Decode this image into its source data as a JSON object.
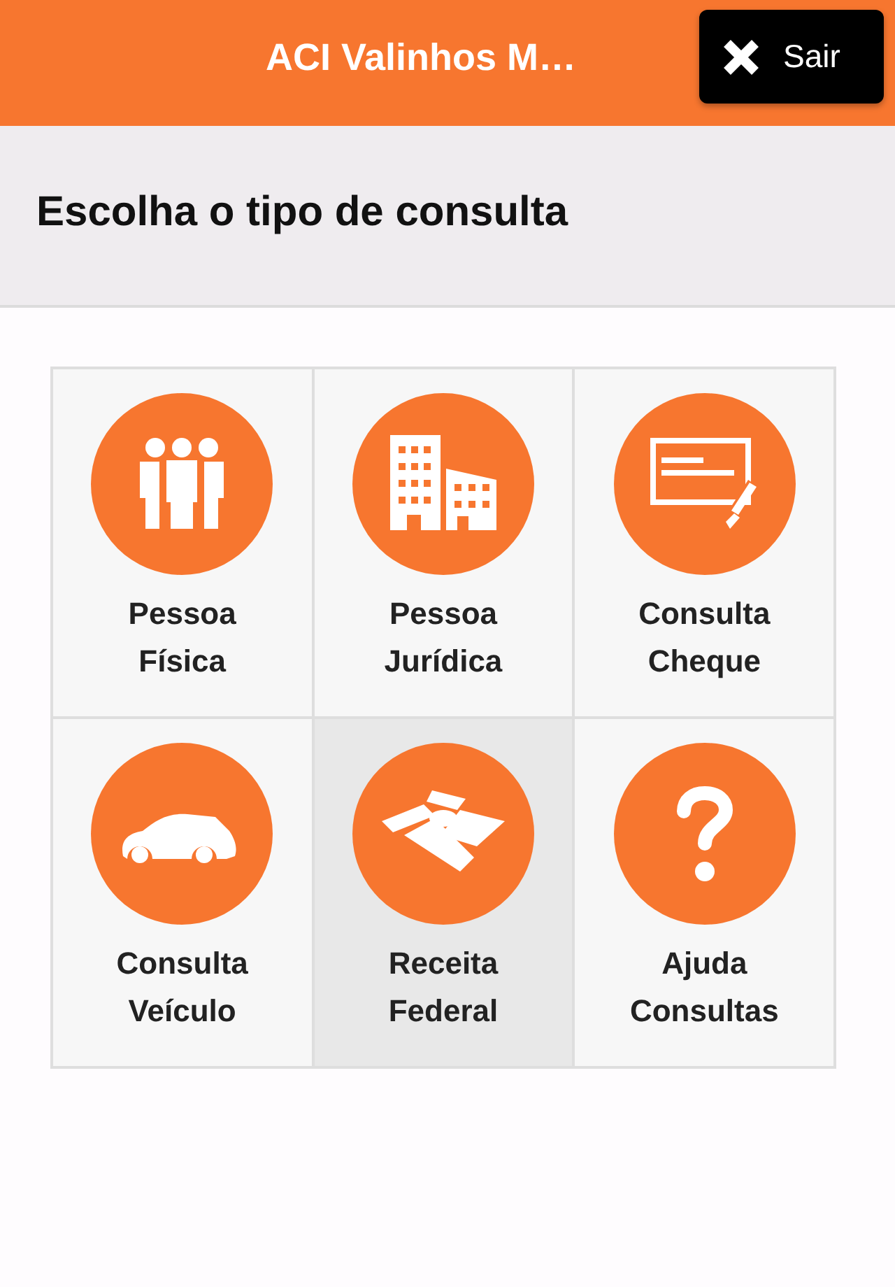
{
  "header": {
    "title": "ACI Valinhos M…",
    "logout_button": "Sair"
  },
  "subheader": {
    "title": "Escolha o tipo de consulta"
  },
  "tiles": [
    {
      "label": "Pessoa Física",
      "selected": false
    },
    {
      "label": "Pessoa Jurídica",
      "selected": false
    },
    {
      "label": "Consulta Cheque",
      "selected": false
    },
    {
      "label": "Consulta Veículo",
      "selected": false
    },
    {
      "label": "Receita Federal",
      "selected": true
    },
    {
      "label": "Ajuda Consultas",
      "selected": false
    }
  ]
}
